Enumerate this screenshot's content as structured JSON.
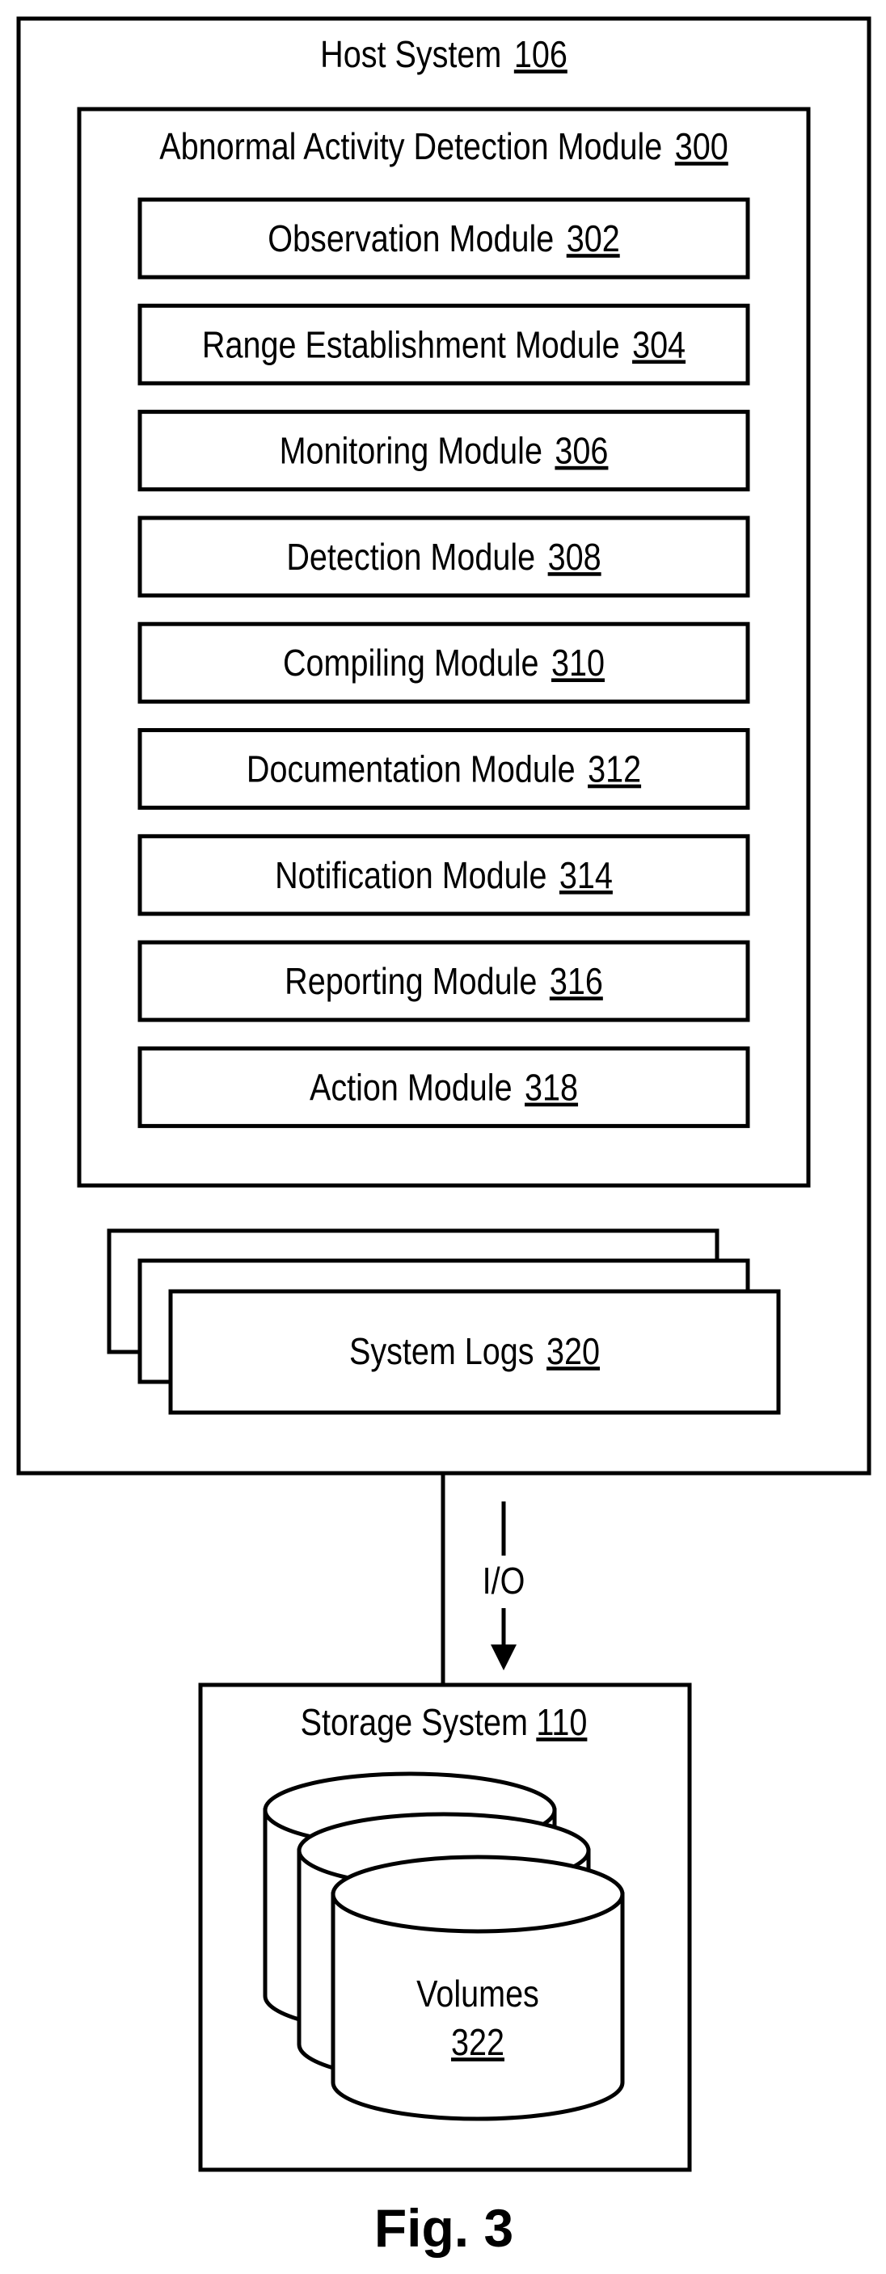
{
  "figure_label": "Fig. 3",
  "host_system": {
    "label": "Host System",
    "ref": "106"
  },
  "detection_module": {
    "label": "Abnormal Activity Detection Module",
    "ref": "300",
    "modules": [
      {
        "label": "Observation Module",
        "ref": "302"
      },
      {
        "label": "Range Establishment Module",
        "ref": "304"
      },
      {
        "label": "Monitoring Module",
        "ref": "306"
      },
      {
        "label": "Detection Module",
        "ref": "308"
      },
      {
        "label": "Compiling Module",
        "ref": "310"
      },
      {
        "label": "Documentation Module",
        "ref": "312"
      },
      {
        "label": "Notification Module",
        "ref": "314"
      },
      {
        "label": "Reporting Module",
        "ref": "316"
      },
      {
        "label": "Action Module",
        "ref": "318"
      }
    ]
  },
  "system_logs": {
    "label": "System Logs",
    "ref": "320"
  },
  "io_connection": {
    "label": "I/O",
    "direction": "down"
  },
  "storage_system": {
    "label": "Storage System",
    "ref": "110",
    "volumes": {
      "label": "Volumes",
      "ref": "322"
    }
  }
}
